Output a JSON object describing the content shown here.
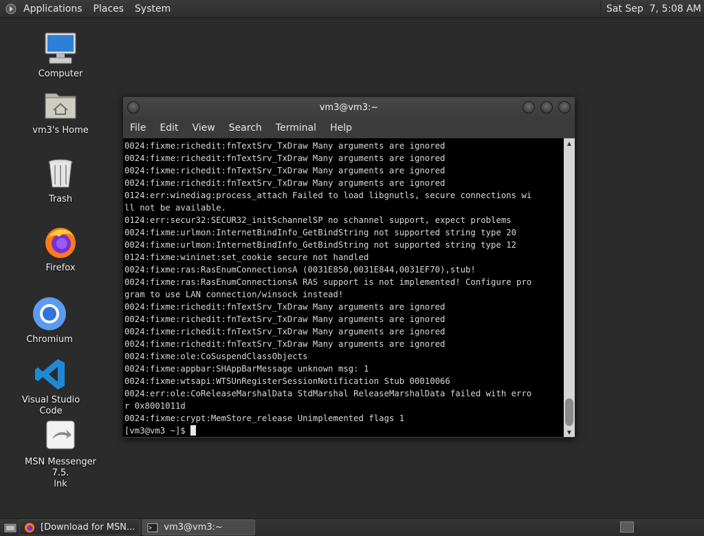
{
  "top_panel": {
    "menus": [
      "Applications",
      "Places",
      "System"
    ],
    "clock": "Sat Sep  7, 5:08 AM"
  },
  "desktop_icons": [
    {
      "label": "Computer",
      "icon": "computer-icon"
    },
    {
      "label": "vm3's Home",
      "icon": "home-folder-icon"
    },
    {
      "label": "Trash",
      "icon": "trash-icon"
    },
    {
      "label": "Firefox",
      "icon": "firefox-icon"
    },
    {
      "label": "Chromium",
      "icon": "chromium-icon"
    },
    {
      "label": "Visual Studio Code",
      "icon": "vscode-icon"
    },
    {
      "label": "MSN Messenger 7.5.\nlnk",
      "icon": "msn-shortcut-icon"
    }
  ],
  "terminal": {
    "title": "vm3@vm3:~",
    "menus": [
      "File",
      "Edit",
      "View",
      "Search",
      "Terminal",
      "Help"
    ],
    "lines": [
      "0024:fixme:richedit:fnTextSrv_TxDraw Many arguments are ignored",
      "0024:fixme:richedit:fnTextSrv_TxDraw Many arguments are ignored",
      "0024:fixme:richedit:fnTextSrv_TxDraw Many arguments are ignored",
      "0024:fixme:richedit:fnTextSrv_TxDraw Many arguments are ignored",
      "0124:err:winediag:process_attach Failed to load libgnutls, secure connections wi",
      "ll not be available.",
      "0124:err:secur32:SECUR32_initSchannelSP no schannel support, expect problems",
      "0024:fixme:urlmon:InternetBindInfo_GetBindString not supported string type 20",
      "0024:fixme:urlmon:InternetBindInfo_GetBindString not supported string type 12",
      "0124:fixme:wininet:set_cookie secure not handled",
      "0024:fixme:ras:RasEnumConnectionsA (0031E850,0031E844,0031EF70),stub!",
      "0024:fixme:ras:RasEnumConnectionsA RAS support is not implemented! Configure pro",
      "gram to use LAN connection/winsock instead!",
      "0024:fixme:richedit:fnTextSrv_TxDraw Many arguments are ignored",
      "0024:fixme:richedit:fnTextSrv_TxDraw Many arguments are ignored",
      "0024:fixme:richedit:fnTextSrv_TxDraw Many arguments are ignored",
      "0024:fixme:richedit:fnTextSrv_TxDraw Many arguments are ignored",
      "0024:fixme:ole:CoSuspendClassObjects",
      "0024:fixme:appbar:SHAppBarMessage unknown msg: 1",
      "0024:fixme:wtsapi:WTSUnRegisterSessionNotification Stub 00010066",
      "0024:err:ole:CoReleaseMarshalData StdMarshal ReleaseMarshalData failed with erro",
      "r 0x8001011d",
      "0024:fixme:crypt:MemStore_release Unimplemented flags 1"
    ],
    "prompt": "[vm3@vm3 ~]$ "
  },
  "taskbar": {
    "tasks": [
      {
        "label": "[Download for MSN...",
        "icon": "firefox-icon",
        "active": false
      },
      {
        "label": "vm3@vm3:~",
        "icon": "terminal-icon",
        "active": true
      }
    ]
  }
}
